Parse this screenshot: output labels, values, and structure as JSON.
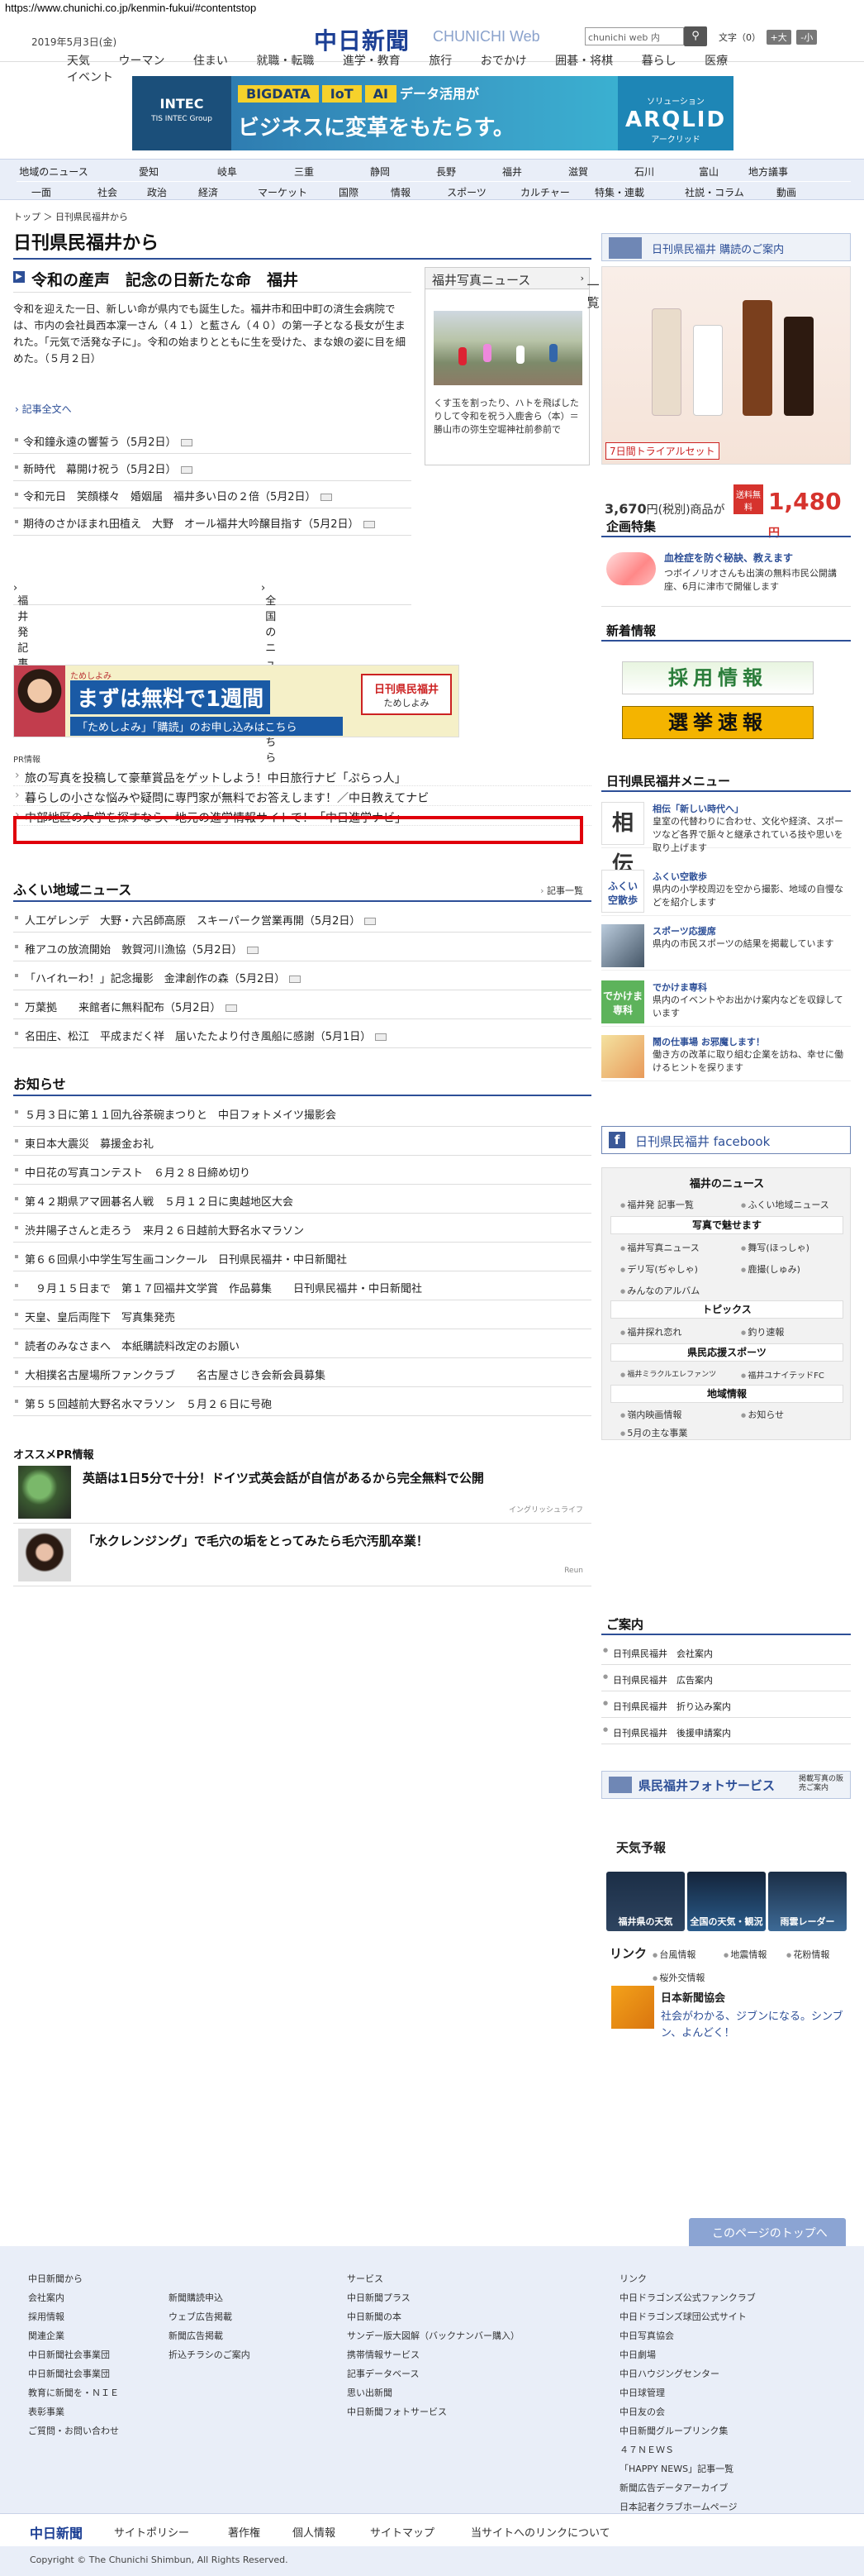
{
  "url": "https://www.chunichi.co.jp/kenmin-fukui/#contentstop",
  "header": {
    "date": "2019年5月3日(金)",
    "logo": "中日新聞",
    "logo_en": "CHUNICHI Web",
    "search_placeholder": "chunichi web 内",
    "fontsize_label": "文字（",
    "fontsize_mid": "）",
    "font_plus": "+大",
    "font_minus": "-小",
    "font_zero": "0",
    "nav": [
      "天気",
      "ウーマン",
      "住まい",
      "就職・転職",
      "進学・教育",
      "旅行",
      "おでかけ",
      "囲碁・将棋",
      "暮らし",
      "医療",
      "イベント"
    ]
  },
  "banner": {
    "left_title": "INTEC",
    "left_sub": "TIS INTEC Group",
    "tags": [
      "BIGDATA",
      "IoT",
      "AI"
    ],
    "tag_suffix": "データ活用が",
    "main": "ビジネスに変革をもたらす。",
    "right_sub": "ソリューション",
    "right": "ARQLID",
    "right_foot": "アークリッド"
  },
  "regnav": {
    "row1": [
      "地域のニュース",
      "愛知",
      "岐阜",
      "三重",
      "静岡",
      "長野",
      "福井",
      "滋賀",
      "石川",
      "富山",
      "地方議事"
    ],
    "row2": [
      "一面",
      "社会",
      "政治",
      "経済",
      "マーケット",
      "国際",
      "スポーツ",
      "カルチャー",
      "特集・連載",
      "社説・コラム",
      "動画",
      "情報"
    ]
  },
  "breadcrumb": "トップ ＞ 日刊県民福井から",
  "page_title": "日刊県民福井から",
  "main": {
    "headline": "令和の産声　記念の日新たな命　福井",
    "lead": "令和を迎えた一日、新しい命が県内でも誕生した。福井市和田中町の済生会病院では、市内の会社員西本凜一さん（４１）と藍さん（４０）の第一子となる長女が生まれた。「元気で活発な子に」。令和の始まりとともに生を受けた、まな娘の姿に目を細めた。（５月２日）",
    "full_article": "記事全文へ",
    "articles": [
      "令和鐘永遠の響誓う（5月2日）",
      "新時代　幕開け祝う（5月2日）",
      "令和元日　笑顔様々　婚姻届　福井多い日の２倍（5月2日）",
      "期待のさかほまれ田植え　大野　オール福井大吟醸目指す（5月2日）"
    ],
    "link_list": "福井発 記事一覧",
    "link_national": "全国のニュースはこちら"
  },
  "photonews": {
    "title": "福井写真ニュース",
    "more": "一覧",
    "caption": "くす玉を割ったり、ハトを飛ばしたりして令和を祝う入鹿舎ら（本）＝勝山市の弥生空堀神社前参前で"
  },
  "adstrip": {
    "t1": "ためしよみ",
    "t2": "まずは無料で1週間",
    "t3": "「ためしよみ」「購読」のお申し込みはこちら",
    "t4": "日刊県民福井",
    "t4s": "ためしよみ"
  },
  "pr": {
    "label": "PR情報",
    "items": [
      "旅の写真を投稿して豪華賞品をゲットしよう！中日旅行ナビ「ぷらっ人」",
      "暮らしの小さな悩みや疑問に専門家が無料でお答えします！／中日教えてナビ",
      "中部地区の大学を探すなら、地元の進学情報サイトで！「中日進学ナビ」"
    ]
  },
  "local": {
    "title": "ふくい地域ニュース",
    "more": "記事一覧",
    "items": [
      "人工ゲレンデ　大野・六呂師高原　スキーパーク営業再開（5月2日）",
      "稚アユの放流開始　敦賀河川漁協（5月2日）",
      "「ハイれーわ！」記念撮影　金津創作の森（5月2日）",
      "万葉拠　　来館者に無料配布（5月2日）",
      "名田庄、松江　平成まだく祥　届いたたより付き風船に感謝（5月1日）"
    ]
  },
  "notice": {
    "title": "お知らせ",
    "items": [
      "５月３日に第１１回九谷茶碗まつりと　中日フォトメイツ撮影会",
      "東日本大震災　募援金お礼",
      "中日花の写真コンテスト　６月２８日締め切り",
      "第４２期県アマ囲碁名人戦　５月１２日に奥越地区大会",
      "渋井陽子さんと走ろう　来月２６日越前大野名水マラソン",
      "第６６回県小中学生写生画コンクール　日刊県民福井・中日新聞社",
      "　９月１５日まで　第１７回福井文学賞　作品募集　　日刊県民福井・中日新聞社",
      "天皇、皇后両陛下　写真集発売",
      "読者のみなさまへ　本紙購読料改定のお願い",
      "大相撲名古屋場所ファンクラブ　　名古屋さじき会新会員募集",
      "第５５回越前大野名水マラソン　５月２６日に号砲"
    ]
  },
  "reco": {
    "title": "オススメPR情報",
    "items": [
      {
        "text": "英語は1日5分で十分！ドイツ式英会話が自信があるから完全無料で公開",
        "src": "イングリッシュライフ"
      },
      {
        "text": "「水クレンジング」で毛穴の垢をとってみたら毛穴汚肌卒業！",
        "src": "Reun"
      }
    ]
  },
  "right": {
    "koudoku": "日刊県民福井 購読のご案内",
    "koudoku_trial": "7日間トライアルセット",
    "koudoku_price": "3,670",
    "koudoku_price_unit": "円(税別)商品が",
    "koudoku_tag": "送料無料",
    "koudoku_big": "1,480",
    "koudoku_big_unit": "円",
    "kikaku_title": "企画特集",
    "kikaku_t": "血栓症を防ぐ秘訣、教えます",
    "kikaku_s": "つボイノリオさんも出演の無料市民公開講座、6月に津市で開催します",
    "shinchaku": "新着情報",
    "saiyo": "採用情報",
    "senkyo": "選挙速報",
    "menu_title": "日刊県民福井メニュー",
    "menu": [
      {
        "t": "相伝「新しい時代へ」",
        "s": "皇室の代替わりに合わせ、文化や経済、スポーツなど各界で脈々と継承されている技や思いを取り上げます"
      },
      {
        "t": "ふくい空散歩",
        "s": "県内の小学校周辺を空から撮影、地域の自慢などを紹介します"
      },
      {
        "t": "スポーツ応援席",
        "s": "県内の市民スポーツの結果を掲載しています"
      },
      {
        "t": "でかけま専科",
        "s": "県内のイベントやお出かけ案内などを収録しています"
      },
      {
        "t": "鬧の仕事場 お邪魔します！",
        "s": "働き方の改革に取り組む企業を訪ね、幸せに働けるヒントを探ります"
      }
    ],
    "fb": "日刊県民福井 facebook",
    "fnews": "福井のニュース",
    "fnews_items": [
      "福井発 記事一覧",
      "ふくい地域ニュース"
    ],
    "shashin": "写真で魅せます",
    "shashin_items": [
      "福井写真ニュース",
      "舞写(ほっしゃ)",
      "デリ写(ぢゃしゃ)",
      "鹿撮(しゅみ)",
      "みんなのアルバム"
    ],
    "topics": "トピックス",
    "topics_items": [
      "福井探れ恋れ",
      "釣り速報"
    ],
    "sports": "県民応援スポーツ",
    "sports_items": [
      "福井ミラクルエレファンツ",
      "福井ユナイテッドFC"
    ],
    "chiiki": "地域情報",
    "chiiki_items": [
      "嶺内映画情報",
      "お知らせ",
      "5月の主な事業"
    ],
    "annai": "ご案内",
    "annai_items": [
      "日刊県民福井　会社案内",
      "日刊県民福井　広告案内",
      "日刊県民福井　折り込み案内",
      "日刊県民福井　後援申請案内"
    ],
    "photosvc": "県民福井フォトサービス",
    "photosvc_sub": "掲載写真の販売ご案内",
    "weather": "天気予報",
    "wx": [
      "福井県の天気",
      "全国の天気・観況",
      "雨雲レーダー"
    ],
    "links": "リンク",
    "link_items": [
      "台風情報",
      "地震情報",
      "花粉情報",
      "桜外交情報"
    ],
    "jpa": "日本新聞協会",
    "jpa_text": "社会がわかる、ジブンになる。シンブン、よんどく！"
  },
  "footer": {
    "totop": "このページのトップへ",
    "col1_h": "中日新聞から",
    "col1": [
      "会社案内",
      "採用情報",
      "関連企業",
      "中日新聞社会事業団",
      "中日新聞社会事業団",
      "教育に新聞を・ＮＩＥ",
      "表彰事業",
      "ご質問・お問い合わせ"
    ],
    "col2": [
      "新聞購読申込",
      "ウェブ広告掲載",
      "新聞広告掲載",
      "折込チラシのご案内"
    ],
    "col3_h": "サービス",
    "col3": [
      "中日新聞プラス",
      "中日新聞の本",
      "サンデー版大図解（バックナンバー購入）",
      "携帯情報サービス",
      "記事データベース",
      "思い出新聞",
      "中日新聞フォトサービス"
    ],
    "col4_h": "リンク",
    "col4": [
      "中日ドラゴンズ公式ファンクラブ",
      "中日ドラゴンズ球団公式サイト",
      "中日写真協会",
      "中日劇場",
      "中日ハウジングセンター",
      "中日球管理",
      "中日友の会",
      "中日新聞グループリンク集",
      "４７ＮＥＷＳ",
      "「HAPPY NEWS」記事一覧",
      "新聞広告データアーカイブ",
      "日本記者クラブホームページ"
    ],
    "bar_logo": "中日新聞",
    "bar": [
      "サイトポリシー",
      "著作権",
      "個人情報",
      "サイトマップ",
      "当サイトへのリンクについて"
    ],
    "copyright": "Copyright © The Chunichi Shimbun, All Rights Reserved."
  }
}
